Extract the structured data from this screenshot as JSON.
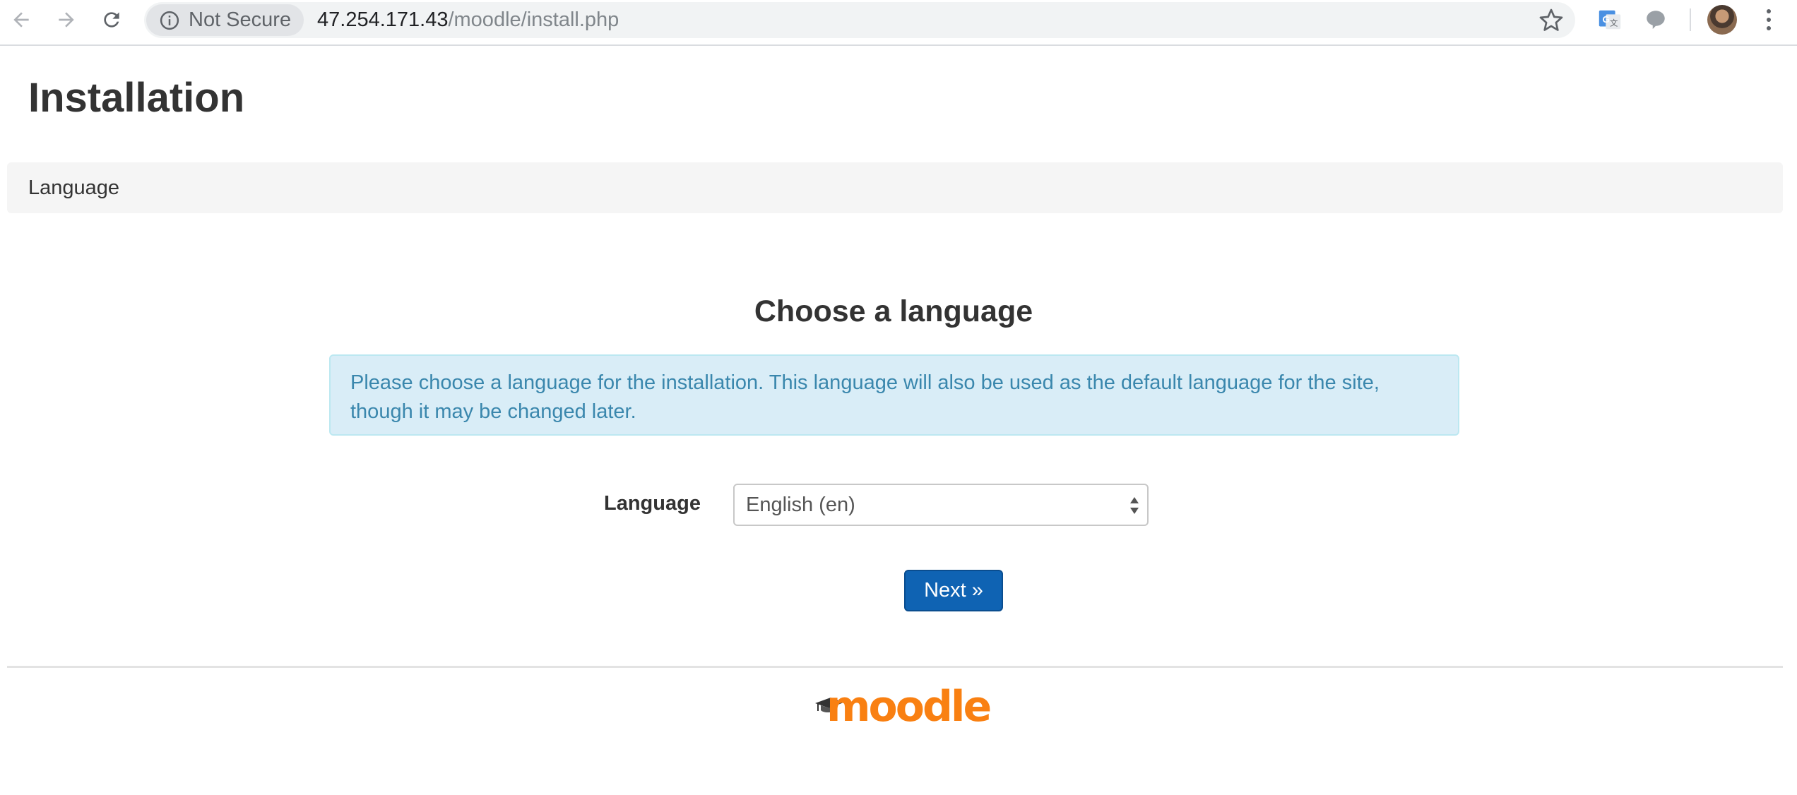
{
  "browser": {
    "security_label": "Not Secure",
    "url_host": "47.254.171.43",
    "url_path": "/moodle/install.php"
  },
  "page": {
    "title": "Installation",
    "breadcrumb": "Language",
    "heading": "Choose a language",
    "info_text": "Please choose a language for the installation. This language will also be used as the default language for the site, though it may be changed later.",
    "language_label": "Language",
    "language_selected": "English (en)",
    "next_button": "Next »",
    "logo_text": "moodle"
  },
  "colors": {
    "accent": "#0f63b3",
    "alert_bg": "#d9edf7",
    "alert_text": "#3a87ad",
    "logo": "#f98012"
  }
}
